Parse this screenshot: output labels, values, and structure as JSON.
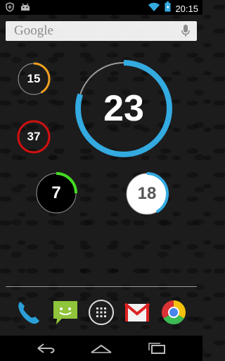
{
  "status_bar": {
    "time": "20:15",
    "left_icons": [
      "shield-icon",
      "android-icon"
    ],
    "right_icons": [
      "wifi-icon",
      "battery-icon"
    ]
  },
  "search_widget": {
    "logo_text": "Google",
    "mic_icon": "mic-icon"
  },
  "ring_widgets": [
    {
      "name": "ring-15",
      "value": "15",
      "progress": 0.42,
      "color": "#f0a020",
      "fill": "transparent",
      "text_color": "#ffffff"
    },
    {
      "name": "ring-23",
      "value": "23",
      "progress": 0.8,
      "color": "#33aae0",
      "fill": "transparent",
      "text_color": "#ffffff"
    },
    {
      "name": "ring-37",
      "value": "37",
      "progress": 1.0,
      "color": "#d11010",
      "fill": "transparent",
      "text_color": "#ffffff"
    },
    {
      "name": "ring-7",
      "value": "7",
      "progress": 0.25,
      "color": "#44dd22",
      "fill": "#000000",
      "text_color": "#ffffff"
    },
    {
      "name": "ring-18",
      "value": "18",
      "progress": 0.42,
      "color": "#33aae0",
      "fill": "#ffffff",
      "text_color": "#555555"
    }
  ],
  "dock": {
    "apps": [
      "phone-icon",
      "messaging-icon",
      "app-drawer-icon",
      "gmail-icon",
      "chrome-icon"
    ]
  },
  "nav_bar": {
    "buttons": [
      "back-icon",
      "home-icon",
      "recents-icon"
    ]
  }
}
